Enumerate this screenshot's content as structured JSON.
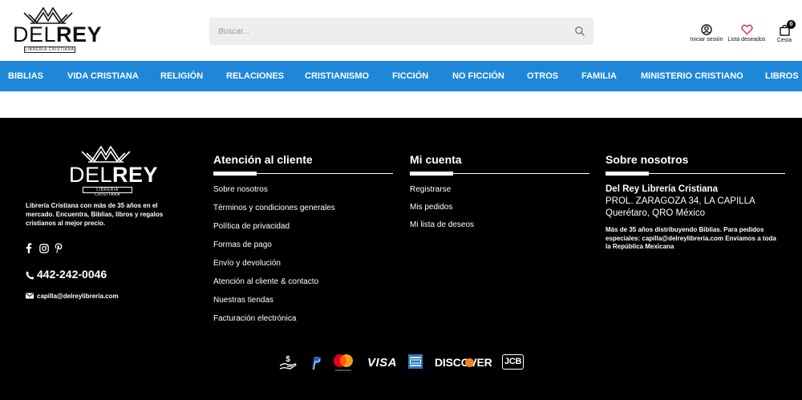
{
  "header": {
    "logo": {
      "del": "DEL",
      "rey": "REY",
      "tagline": "LIBRERÍA CRISTIANA"
    },
    "search": {
      "placeholder": "Buscar..."
    },
    "account_label": "Iniciar sesión",
    "wishlist_label": "Lista deseados",
    "cart_label": "Cesta",
    "cart_count": "0"
  },
  "nav": {
    "items": [
      "BIBLIAS",
      "VIDA CRISTIANA",
      "RELIGIÓN",
      "RELACIONES",
      "CRISTIANISMO",
      "FICCIÓN",
      "NO FICCIÓN",
      "OTROS",
      "FAMILIA",
      "MINISTERIO CRISTIANO",
      "LIBROS"
    ]
  },
  "footer": {
    "logo": {
      "del": "DEL",
      "rey": "REY",
      "tagline": "LIBRERÍA CRISTIANA"
    },
    "about": "Librería Cristiana con más de 35 años en el mercado. Encuentra, Biblias, libros y regalos cristianos al mejor precio.",
    "social": [
      "facebook-icon",
      "instagram-icon",
      "pinterest-icon"
    ],
    "phone": "442-242-0046",
    "email": "capilla@delreylibreria.com",
    "customer_service": {
      "title": "Atención al cliente",
      "links": [
        "Sobre nosotros",
        "Términos y condiciones generales",
        "Política de privacidad",
        "Formas de pago",
        "Envío y devolución",
        "Atención al cliente & contacto",
        "Nuestras tiendas",
        "Facturación electrónica"
      ]
    },
    "account": {
      "title": "Mi cuenta",
      "links": [
        "Registrarse",
        "Mis pedidos",
        "Mi lista de deseos"
      ]
    },
    "about_us": {
      "title": "Sobre nosotros",
      "store_name": "Del Rey Librería Cristiana",
      "address_1": "PROL. ZARAGOZA 34, LA CAPILLA",
      "address_2": "Querétaro, QRO México",
      "note": "Más de 35 años distribuyendo Biblias. Para pedidos especiales: capilla@delreylibreria.com Enviamos a toda la República Mexicana"
    },
    "payments": {
      "visa": "VISA",
      "discover": "DISCOVER",
      "jcb": "JCB",
      "mastercard": "mastercard"
    }
  },
  "colors": {
    "nav_bg": "#1e87d8",
    "footer_bg": "#000000",
    "accent_heart": "#e0344b"
  }
}
